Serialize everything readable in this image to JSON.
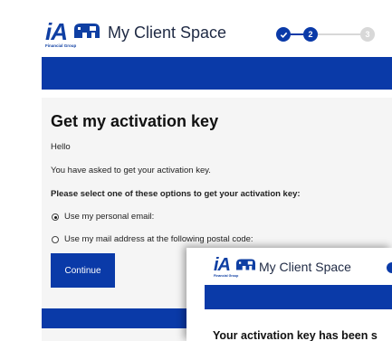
{
  "back_card": {
    "logo": {
      "text": "iA",
      "subtext": "Financial Group"
    },
    "app_title": "My Client Space",
    "stepper": [
      {
        "state": "done",
        "label": ""
      },
      {
        "state": "active",
        "label": "2"
      },
      {
        "state": "todo",
        "label": "3"
      }
    ],
    "heading": "Get my activation key",
    "greeting": "Hello",
    "intro": "You have asked to get your activation key.",
    "instruction": "Please select one of these options to get your activation key:",
    "options": [
      {
        "label": "Use my personal email:",
        "selected": true
      },
      {
        "label": "Use my mail address at the following postal code:",
        "selected": false
      }
    ],
    "continue_label": "Continue"
  },
  "front_card": {
    "logo": {
      "text": "iA",
      "subtext": "Financial Group"
    },
    "app_title": "My Client Space",
    "heading": "Your activation key has been s"
  },
  "colors": {
    "brand_blue": "#0a3aa8",
    "logo_blue": "#0f3fa3",
    "panel_bg": "#f5f5f5",
    "step_todo": "#d8d8d8"
  }
}
